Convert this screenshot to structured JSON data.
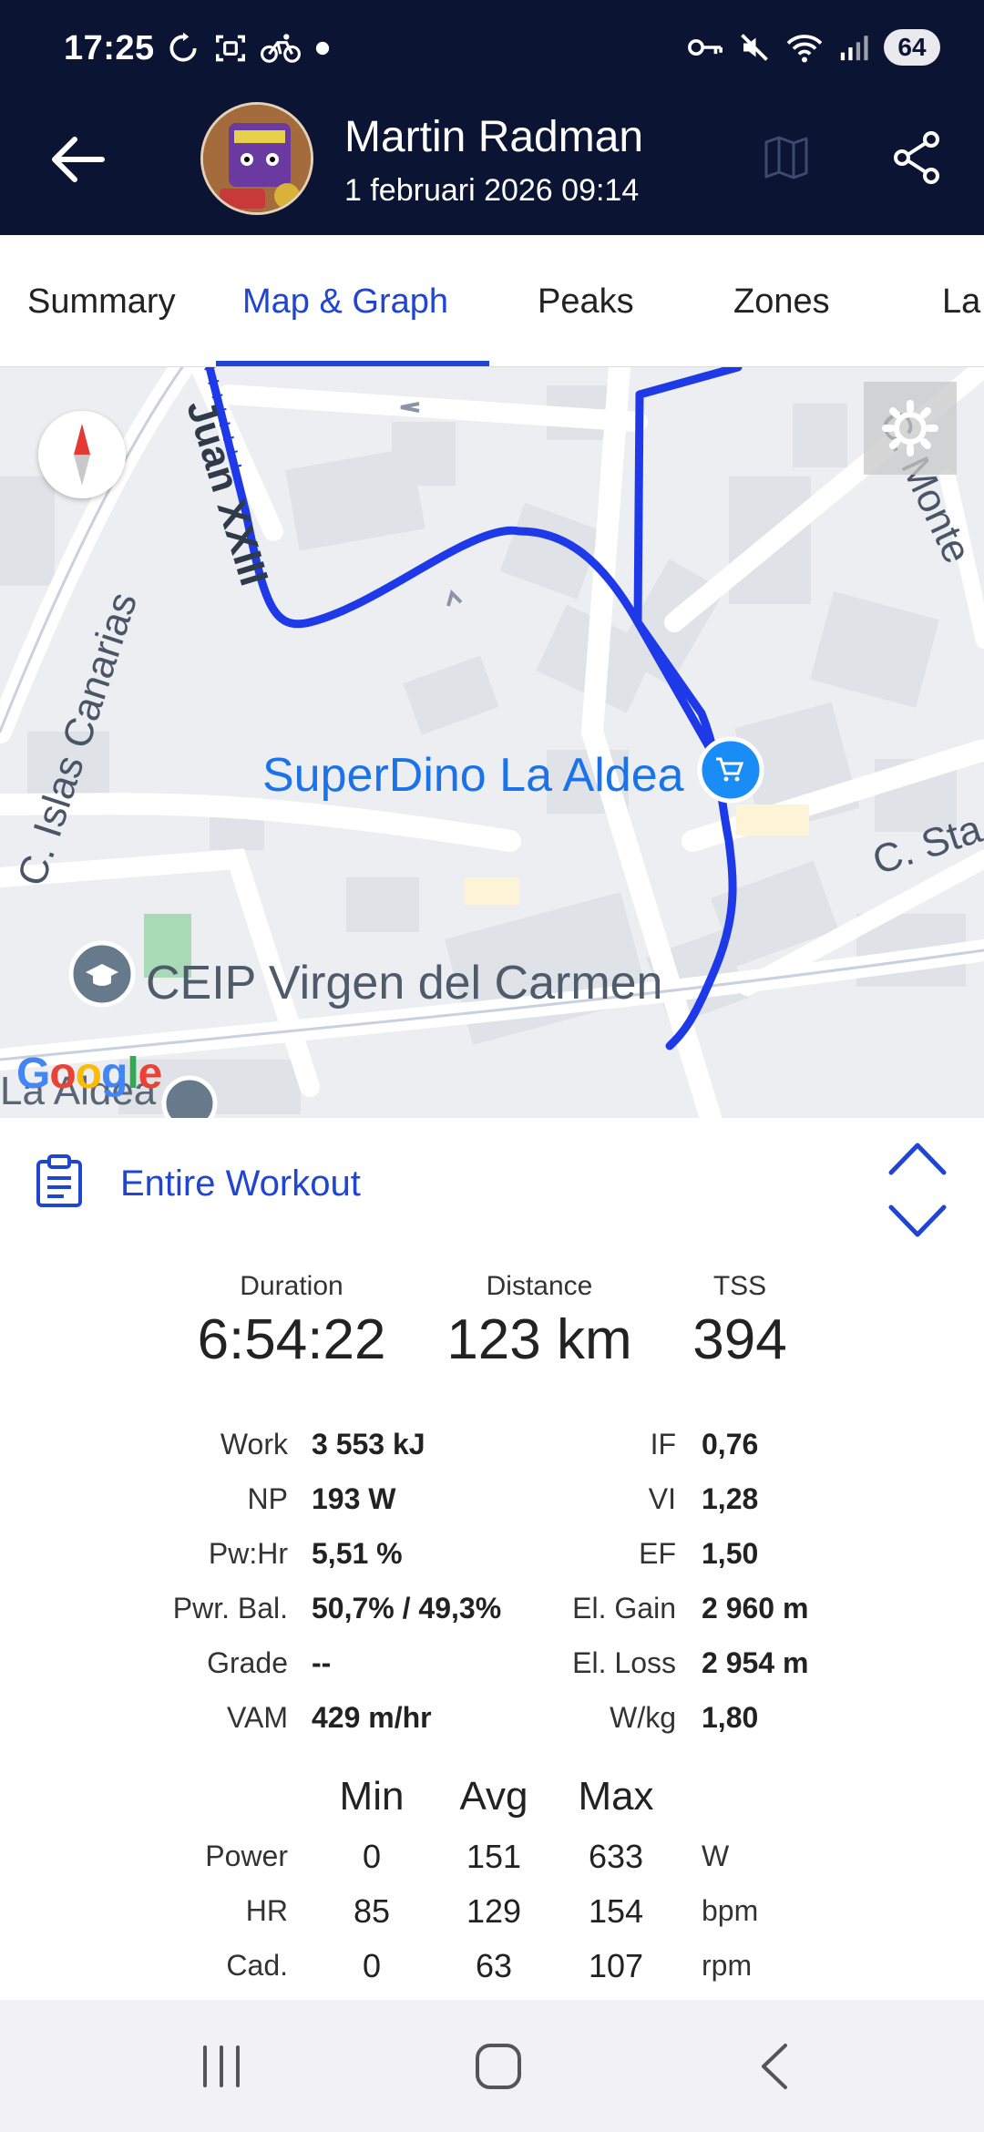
{
  "status_bar": {
    "time": "17:25",
    "battery": "64"
  },
  "header": {
    "athlete_name": "Martin Radman",
    "activity_datetime": "1 februari 2026 09:14",
    "colors": {
      "background": "#0b1433",
      "accent": "#2145d3"
    }
  },
  "tabs": [
    {
      "label": "Summary",
      "active": false
    },
    {
      "label": "Map & Graph",
      "active": true
    },
    {
      "label": "Peaks",
      "active": false
    },
    {
      "label": "Zones",
      "active": false
    },
    {
      "label": "La",
      "active": false
    }
  ],
  "map": {
    "poi_store": "SuperDino La Aldea",
    "poi_school": "CEIP Virgen del Carmen",
    "streets": [
      "Juan XXIII",
      "C. Islas Canarias",
      "C. Monte",
      "C. Sta",
      "La Aldea"
    ],
    "attribution": "Google"
  },
  "workout": {
    "range_label": "Entire Workout",
    "big_stats": [
      {
        "label": "Duration",
        "value": "6:54:22"
      },
      {
        "label": "Distance",
        "value": "123 km"
      },
      {
        "label": "TSS",
        "value": "394"
      }
    ],
    "metrics_left": [
      {
        "label": "Work",
        "value": "3 553 kJ"
      },
      {
        "label": "NP",
        "value": "193 W"
      },
      {
        "label": "Pw:Hr",
        "value": "5,51 %"
      },
      {
        "label": "Pwr. Bal.",
        "value": "50,7% / 49,3%"
      },
      {
        "label": "Grade",
        "value": "--"
      },
      {
        "label": "VAM",
        "value": "429 m/hr"
      }
    ],
    "metrics_right": [
      {
        "label": "IF",
        "value": "0,76"
      },
      {
        "label": "VI",
        "value": "1,28"
      },
      {
        "label": "EF",
        "value": "1,50"
      },
      {
        "label": "El. Gain",
        "value": "2 960 m"
      },
      {
        "label": "El. Loss",
        "value": "2 954 m"
      },
      {
        "label": "W/kg",
        "value": "1,80"
      }
    ],
    "minmax": {
      "headers": [
        "Min",
        "Avg",
        "Max"
      ],
      "rows": [
        {
          "label": "Power",
          "min": "0",
          "avg": "151",
          "max": "633",
          "unit": "W"
        },
        {
          "label": "HR",
          "min": "85",
          "avg": "129",
          "max": "154",
          "unit": "bpm"
        },
        {
          "label": "Cad.",
          "min": "0",
          "avg": "63",
          "max": "107",
          "unit": "rpm"
        }
      ]
    }
  }
}
